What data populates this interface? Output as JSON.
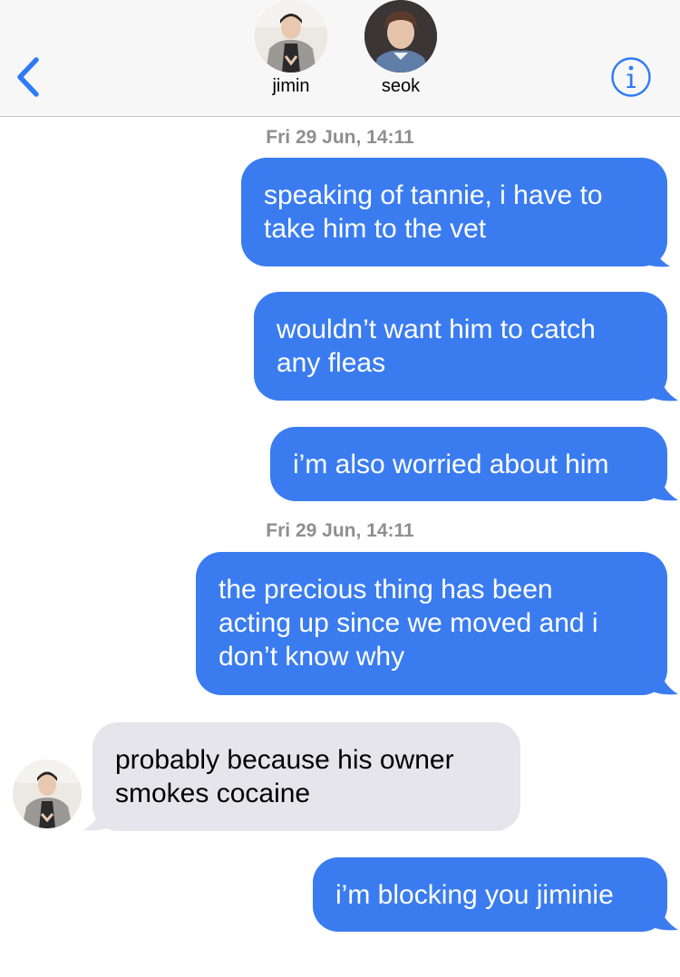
{
  "header": {
    "back_icon": "chevron-left-icon",
    "info_icon": "info-icon",
    "accent_color": "#2f7bf5",
    "contacts": [
      {
        "name": "jimin"
      },
      {
        "name": "seok"
      }
    ]
  },
  "conversation": {
    "outgoing_color": "#3a7cf0",
    "incoming_color": "#e6e5eb",
    "items": [
      {
        "type": "timestamp",
        "text": "Fri 29 Jun, 14:11"
      },
      {
        "type": "message",
        "direction": "outgoing",
        "text": "speaking of tannie, i have to\ntake him to the vet"
      },
      {
        "type": "message",
        "direction": "outgoing",
        "text": "wouldn’t want him to catch\nany fleas"
      },
      {
        "type": "message",
        "direction": "outgoing",
        "text": "i’m also worried about him"
      },
      {
        "type": "timestamp",
        "text": "Fri 29 Jun, 14:11"
      },
      {
        "type": "message",
        "direction": "outgoing",
        "text": "the precious thing has been\nacting up since we moved and i\ndon’t know why"
      },
      {
        "type": "message",
        "direction": "incoming",
        "text": "probably because his owner\nsmokes cocaine"
      },
      {
        "type": "message",
        "direction": "outgoing",
        "text": "i’m blocking you jiminie"
      }
    ]
  }
}
